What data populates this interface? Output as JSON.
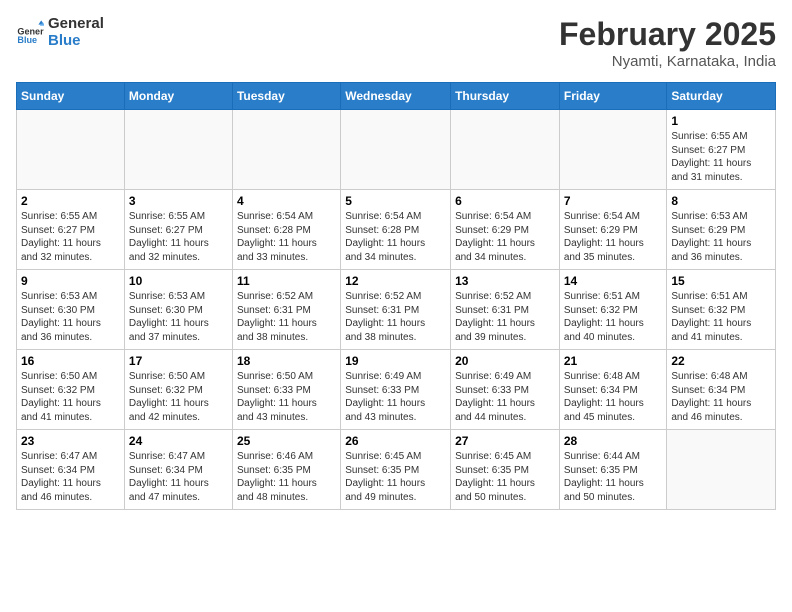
{
  "header": {
    "logo_general": "General",
    "logo_blue": "Blue",
    "title": "February 2025",
    "subtitle": "Nyamti, Karnataka, India"
  },
  "calendar": {
    "days_of_week": [
      "Sunday",
      "Monday",
      "Tuesday",
      "Wednesday",
      "Thursday",
      "Friday",
      "Saturday"
    ],
    "weeks": [
      [
        {
          "day": "",
          "info": ""
        },
        {
          "day": "",
          "info": ""
        },
        {
          "day": "",
          "info": ""
        },
        {
          "day": "",
          "info": ""
        },
        {
          "day": "",
          "info": ""
        },
        {
          "day": "",
          "info": ""
        },
        {
          "day": "1",
          "info": "Sunrise: 6:55 AM\nSunset: 6:27 PM\nDaylight: 11 hours\nand 31 minutes."
        }
      ],
      [
        {
          "day": "2",
          "info": "Sunrise: 6:55 AM\nSunset: 6:27 PM\nDaylight: 11 hours\nand 32 minutes."
        },
        {
          "day": "3",
          "info": "Sunrise: 6:55 AM\nSunset: 6:27 PM\nDaylight: 11 hours\nand 32 minutes."
        },
        {
          "day": "4",
          "info": "Sunrise: 6:54 AM\nSunset: 6:28 PM\nDaylight: 11 hours\nand 33 minutes."
        },
        {
          "day": "5",
          "info": "Sunrise: 6:54 AM\nSunset: 6:28 PM\nDaylight: 11 hours\nand 34 minutes."
        },
        {
          "day": "6",
          "info": "Sunrise: 6:54 AM\nSunset: 6:29 PM\nDaylight: 11 hours\nand 34 minutes."
        },
        {
          "day": "7",
          "info": "Sunrise: 6:54 AM\nSunset: 6:29 PM\nDaylight: 11 hours\nand 35 minutes."
        },
        {
          "day": "8",
          "info": "Sunrise: 6:53 AM\nSunset: 6:29 PM\nDaylight: 11 hours\nand 36 minutes."
        }
      ],
      [
        {
          "day": "9",
          "info": "Sunrise: 6:53 AM\nSunset: 6:30 PM\nDaylight: 11 hours\nand 36 minutes."
        },
        {
          "day": "10",
          "info": "Sunrise: 6:53 AM\nSunset: 6:30 PM\nDaylight: 11 hours\nand 37 minutes."
        },
        {
          "day": "11",
          "info": "Sunrise: 6:52 AM\nSunset: 6:31 PM\nDaylight: 11 hours\nand 38 minutes."
        },
        {
          "day": "12",
          "info": "Sunrise: 6:52 AM\nSunset: 6:31 PM\nDaylight: 11 hours\nand 38 minutes."
        },
        {
          "day": "13",
          "info": "Sunrise: 6:52 AM\nSunset: 6:31 PM\nDaylight: 11 hours\nand 39 minutes."
        },
        {
          "day": "14",
          "info": "Sunrise: 6:51 AM\nSunset: 6:32 PM\nDaylight: 11 hours\nand 40 minutes."
        },
        {
          "day": "15",
          "info": "Sunrise: 6:51 AM\nSunset: 6:32 PM\nDaylight: 11 hours\nand 41 minutes."
        }
      ],
      [
        {
          "day": "16",
          "info": "Sunrise: 6:50 AM\nSunset: 6:32 PM\nDaylight: 11 hours\nand 41 minutes."
        },
        {
          "day": "17",
          "info": "Sunrise: 6:50 AM\nSunset: 6:32 PM\nDaylight: 11 hours\nand 42 minutes."
        },
        {
          "day": "18",
          "info": "Sunrise: 6:50 AM\nSunset: 6:33 PM\nDaylight: 11 hours\nand 43 minutes."
        },
        {
          "day": "19",
          "info": "Sunrise: 6:49 AM\nSunset: 6:33 PM\nDaylight: 11 hours\nand 43 minutes."
        },
        {
          "day": "20",
          "info": "Sunrise: 6:49 AM\nSunset: 6:33 PM\nDaylight: 11 hours\nand 44 minutes."
        },
        {
          "day": "21",
          "info": "Sunrise: 6:48 AM\nSunset: 6:34 PM\nDaylight: 11 hours\nand 45 minutes."
        },
        {
          "day": "22",
          "info": "Sunrise: 6:48 AM\nSunset: 6:34 PM\nDaylight: 11 hours\nand 46 minutes."
        }
      ],
      [
        {
          "day": "23",
          "info": "Sunrise: 6:47 AM\nSunset: 6:34 PM\nDaylight: 11 hours\nand 46 minutes."
        },
        {
          "day": "24",
          "info": "Sunrise: 6:47 AM\nSunset: 6:34 PM\nDaylight: 11 hours\nand 47 minutes."
        },
        {
          "day": "25",
          "info": "Sunrise: 6:46 AM\nSunset: 6:35 PM\nDaylight: 11 hours\nand 48 minutes."
        },
        {
          "day": "26",
          "info": "Sunrise: 6:45 AM\nSunset: 6:35 PM\nDaylight: 11 hours\nand 49 minutes."
        },
        {
          "day": "27",
          "info": "Sunrise: 6:45 AM\nSunset: 6:35 PM\nDaylight: 11 hours\nand 50 minutes."
        },
        {
          "day": "28",
          "info": "Sunrise: 6:44 AM\nSunset: 6:35 PM\nDaylight: 11 hours\nand 50 minutes."
        },
        {
          "day": "",
          "info": ""
        }
      ]
    ]
  }
}
